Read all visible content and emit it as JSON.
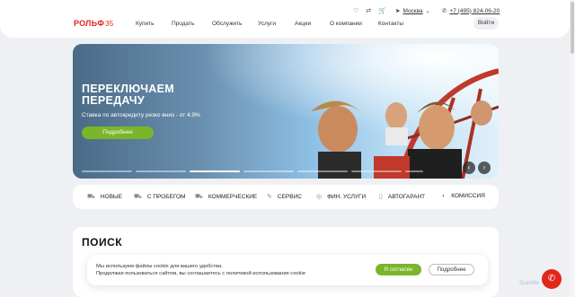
{
  "header": {
    "logo_text": "РОЛЬФ",
    "logo_number": "35",
    "nav": [
      {
        "label": "Купить"
      },
      {
        "label": "Продать"
      },
      {
        "label": "Обслужить"
      },
      {
        "label": "Услуги"
      },
      {
        "label": "Акции"
      },
      {
        "label": "О компании"
      },
      {
        "label": "Контакты"
      }
    ],
    "icons": [
      "heart-icon",
      "compare-icon",
      "cart-icon"
    ],
    "city": "Москва",
    "phone": "+7 (495) 824-06-20",
    "login": "Войти"
  },
  "hero": {
    "title": "ПЕРЕКЛЮЧАЕМ ПЕРЕДАЧУ",
    "subtitle": "Ставка по автокредиту резко вниз - от 4.9%",
    "button": "Подробнее",
    "slides_total": 7,
    "active_slide": 3
  },
  "categories": [
    {
      "label": "НОВЫЕ",
      "icon": "car-icon"
    },
    {
      "label": "С ПРОБЕГОМ",
      "icon": "used-car-icon"
    },
    {
      "label": "КОММЕРЧЕСКИЕ",
      "icon": "truck-icon"
    },
    {
      "label": "СЕРВИС",
      "icon": "wrench-icon"
    },
    {
      "label": "ФИН. УСЛУГИ",
      "icon": "finance-icon"
    },
    {
      "label": "АВТОГАРАНТ",
      "icon": "shield-icon"
    },
    {
      "label": "КОМИССИЯ",
      "icon": "commission-icon"
    }
  ],
  "search": {
    "title": "ПОИСК"
  },
  "cookie": {
    "line1": "Мы используем файлы cookie для вашего удобства.",
    "line2": "Продолжая пользоваться сайтом, вы соглашаетесь с политикой использования cookie",
    "agree": "Я согласен",
    "more": "Подробнее"
  },
  "watermark": "ScanMe",
  "colors": {
    "brand_red": "#e1261c",
    "accent_green": "#7ab52a"
  }
}
